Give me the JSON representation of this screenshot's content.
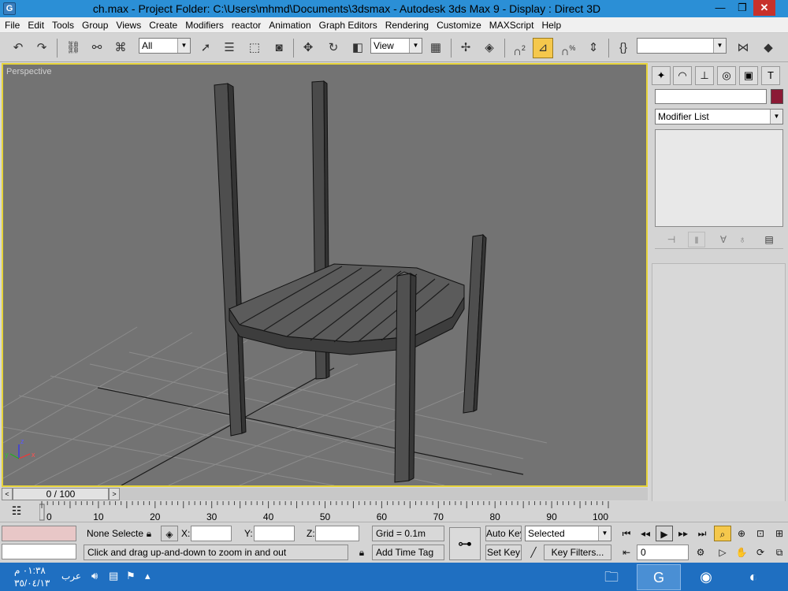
{
  "titlebar": {
    "title": "ch.max      - Project Folder: C:\\Users\\mhmd\\Documents\\3dsmax      - Autodesk 3ds Max 9      - Display : Direct 3D",
    "app_icon_glyph": "G",
    "minimize": "—",
    "maximize": "❐",
    "close": "✕"
  },
  "menu": [
    "File",
    "Edit",
    "Tools",
    "Group",
    "Views",
    "Create",
    "Modifiers",
    "reactor",
    "Animation",
    "Graph Editors",
    "Rendering",
    "Customize",
    "MAXScript",
    "Help"
  ],
  "toolbar": {
    "selection_filter": "All",
    "ref_coord": "View",
    "named_selection": "",
    "icons": {
      "undo": "undo-icon",
      "redo": "redo-icon",
      "snap": "3d-snap-icon",
      "angle_snap": "angle-snap-icon",
      "percent_snap": "percent-snap-icon"
    },
    "snap_label": "2",
    "percent_label": "%"
  },
  "viewport": {
    "label": "Perspective",
    "axis_labels": {
      "x": "x",
      "y": "y",
      "z": "z"
    }
  },
  "command_panel": {
    "object_name": "",
    "object_color": "#8b1a35",
    "modifier_list": "Modifier List"
  },
  "time_slider": {
    "position_label": "0 / 100",
    "prev": "<",
    "next": ">"
  },
  "trackbar": {
    "ticks": [
      "0",
      "10",
      "20",
      "30",
      "40",
      "50",
      "60",
      "70",
      "80",
      "90",
      "100"
    ]
  },
  "status": {
    "selection": "None Selecte",
    "x_label": "X:",
    "y_label": "Y:",
    "z_label": "Z:",
    "x_value": "",
    "y_value": "",
    "z_value": "",
    "grid": "Grid = 0.1m",
    "prompt": "Click and drag up-and-down to zoom in and out",
    "add_time_tag": "Add Time Tag",
    "auto_key": "Auto Key",
    "set_key": "Set Key",
    "key_mode": "Selected",
    "key_filters": "Key Filters...",
    "current_frame": "0"
  },
  "taskbar": {
    "time": "٠١:٣٨ م",
    "date": "٣٥/٠٤/١٣",
    "language": "عرب"
  }
}
